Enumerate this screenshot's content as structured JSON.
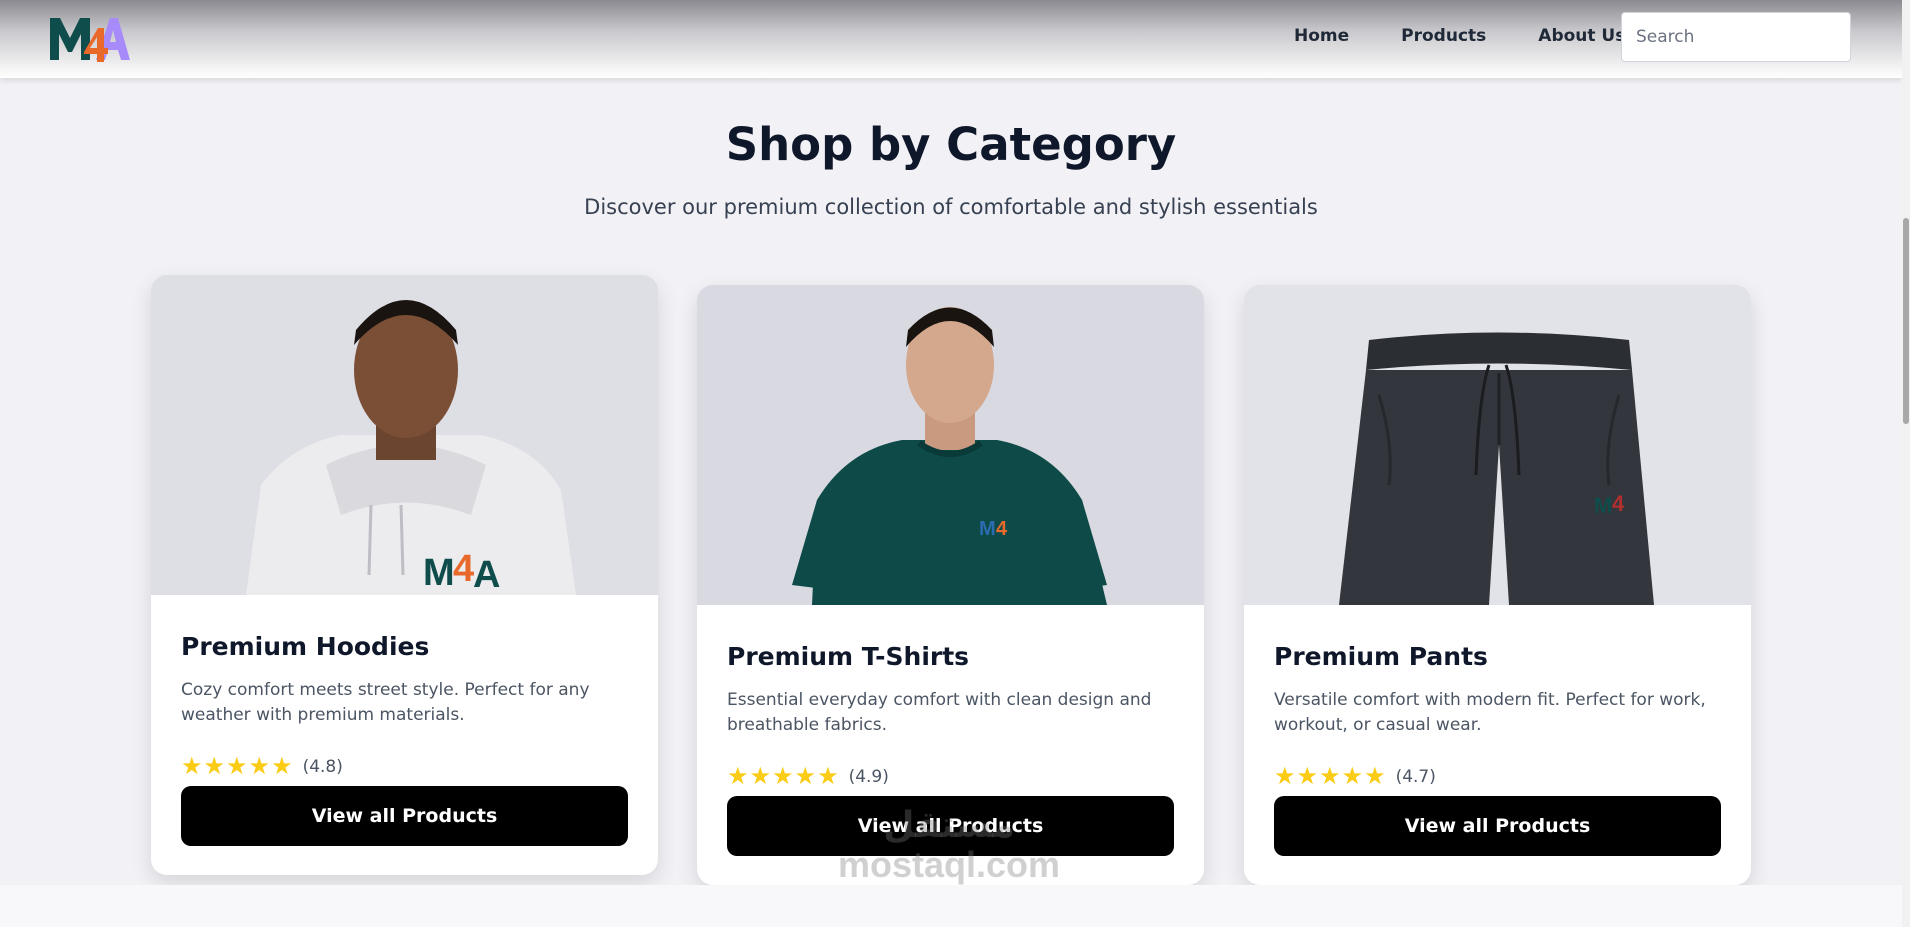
{
  "brand": {
    "logo_text": "M4A",
    "colors": {
      "m": "#0f4c4c",
      "four": "#e8692a",
      "a": "#a78bfa"
    }
  },
  "nav": {
    "links": [
      "Home",
      "Products",
      "About Us"
    ],
    "search_placeholder": "Search"
  },
  "section": {
    "title": "Shop by Category",
    "subtitle": "Discover our premium collection of comfortable and stylish essentials"
  },
  "cards": [
    {
      "title": "Premium Hoodies",
      "description": "Cozy comfort meets street style. Perfect for any weather with premium materials.",
      "stars": "★★★★★",
      "rating": "(4.8)",
      "button": "View all Products",
      "image_icon": "hoodie-model-icon"
    },
    {
      "title": "Premium T-Shirts",
      "description": "Essential everyday comfort with clean design and breathable fabrics.",
      "stars": "★★★★★",
      "rating": "(4.9)",
      "button": "View all Products",
      "image_icon": "tshirt-model-icon"
    },
    {
      "title": "Premium Pants",
      "description": "Versatile comfort with modern fit. Perfect for work, workout, or casual wear.",
      "stars": "★★★★★",
      "rating": "(4.7)",
      "button": "View all Products",
      "image_icon": "pants-icon"
    }
  ],
  "watermark": {
    "arabic": "مستقل",
    "latin": "mostaql.com"
  },
  "accent_colors": {
    "star": "#facc15",
    "button": "#000000",
    "heading": "#0f172a"
  }
}
